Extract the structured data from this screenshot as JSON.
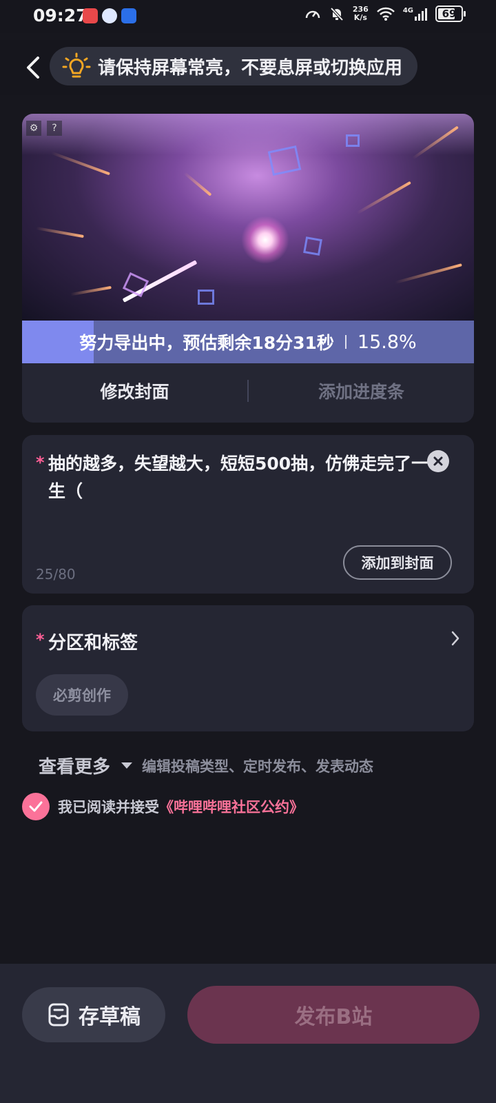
{
  "status_bar": {
    "time": "09:27",
    "net_speed_value": "236",
    "net_speed_unit": "K/s",
    "network": "4G",
    "battery": "69"
  },
  "header": {
    "notice": "请保持屏幕常亮，不要息屏或切换应用"
  },
  "export": {
    "status_text": "努力导出中，预估剩余18分31秒",
    "percent_text": "15.8%",
    "progress": 0.158
  },
  "cover_actions": {
    "edit_cover": "修改封面",
    "add_progress_bar": "添加进度条"
  },
  "title_field": {
    "required_mark": "*",
    "value": "抽的越多，失望越大，短短500抽，仿佛走完了一生（",
    "counter": "25/80",
    "add_to_cover": "添加到封面"
  },
  "category": {
    "required_mark": "*",
    "label": "分区和标签",
    "tag": "必剪创作"
  },
  "more": {
    "label": "查看更多",
    "hint": "编辑投稿类型、定时发布、发表动态"
  },
  "agreement": {
    "text": "我已阅读并接受",
    "link": "《哔哩哔哩社区公约》"
  },
  "bottom": {
    "draft": "存草稿",
    "publish": "发布B站"
  },
  "colors": {
    "accent_pink": "#fb7299",
    "progress_fill": "#7f89ee",
    "card_bg": "#252633",
    "page_bg": "#17171e"
  }
}
